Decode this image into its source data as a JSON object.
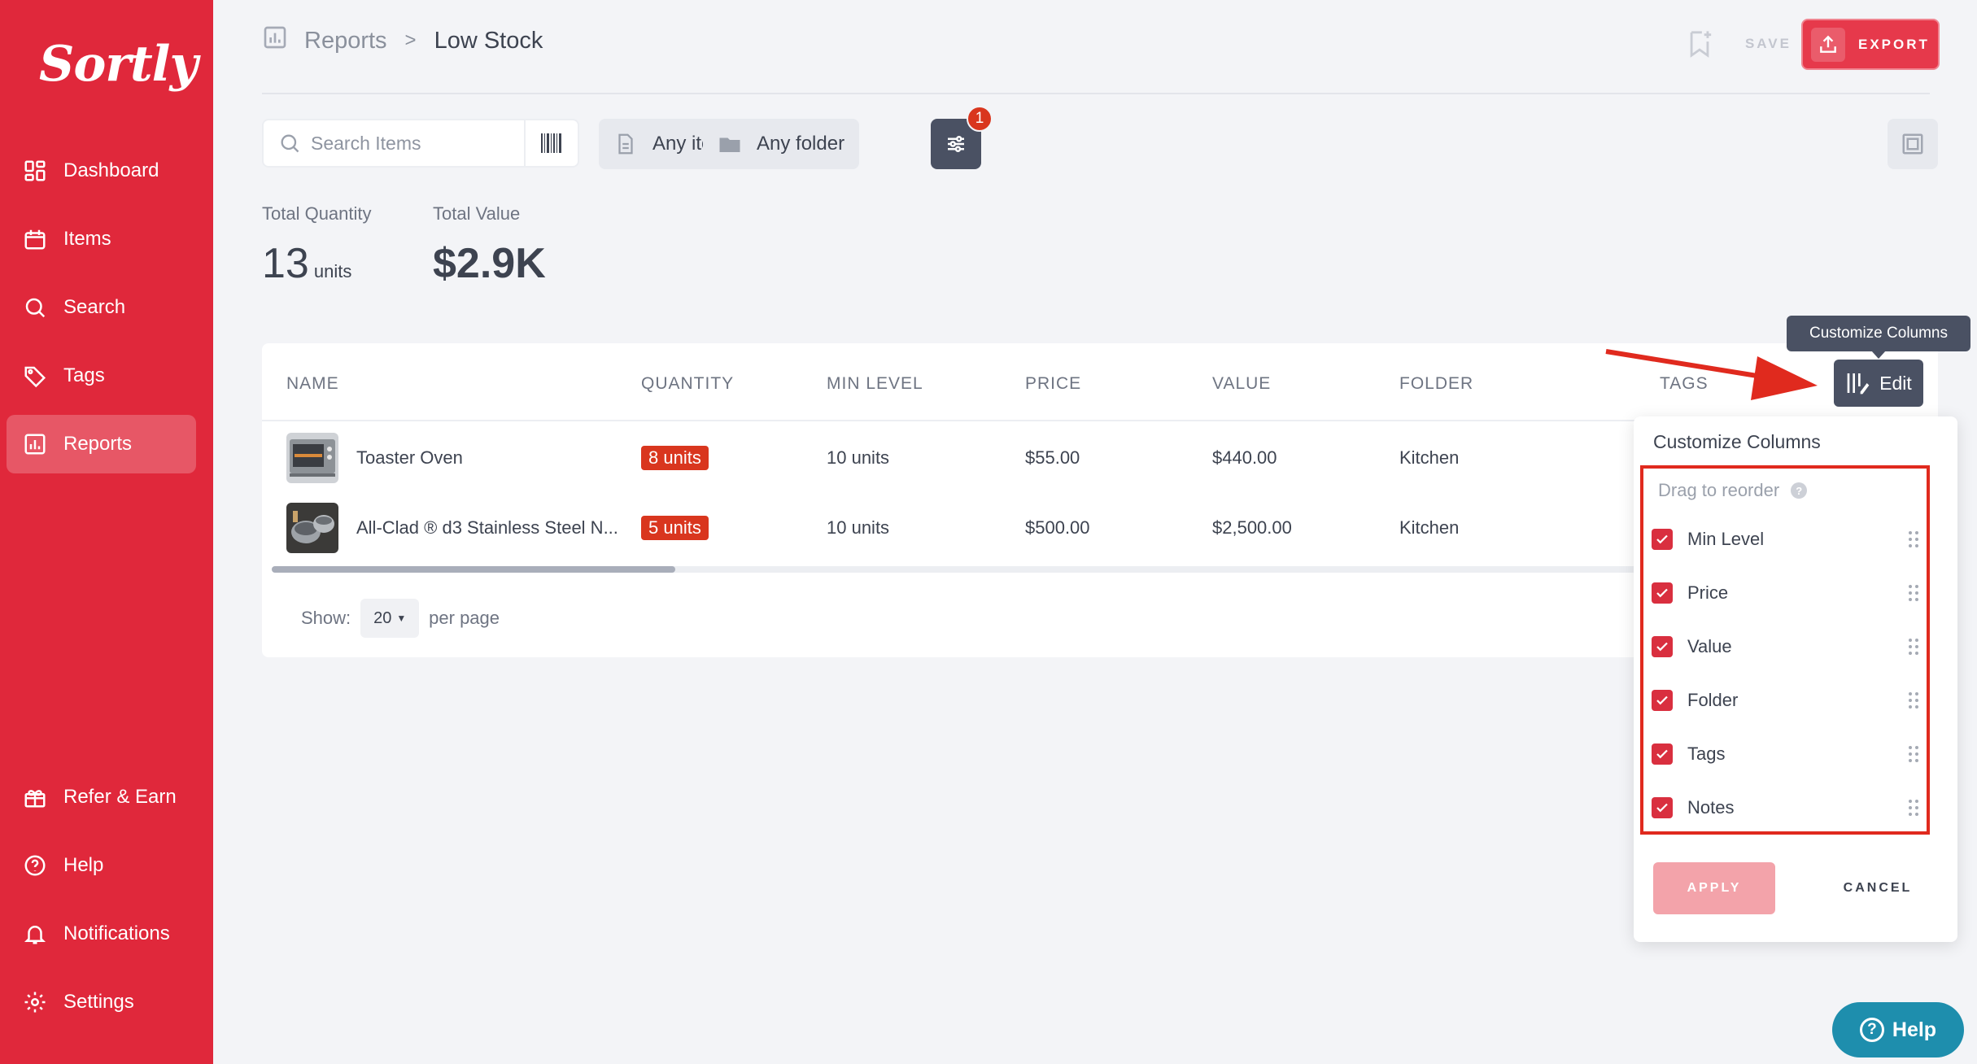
{
  "app": {
    "logo": "Sortly"
  },
  "sidebar": {
    "items": [
      {
        "label": "Dashboard",
        "icon": "dashboard-icon"
      },
      {
        "label": "Items",
        "icon": "items-icon"
      },
      {
        "label": "Search",
        "icon": "search-icon"
      },
      {
        "label": "Tags",
        "icon": "tag-icon"
      },
      {
        "label": "Reports",
        "icon": "reports-icon",
        "active": true
      },
      {
        "label": "Refer & Earn",
        "icon": "gift-icon"
      },
      {
        "label": "Help",
        "icon": "help-icon"
      },
      {
        "label": "Notifications",
        "icon": "bell-icon"
      },
      {
        "label": "Settings",
        "icon": "gear-icon"
      }
    ]
  },
  "header": {
    "breadcrumb_root": "Reports",
    "breadcrumb_sep": ">",
    "breadcrumb_current": "Low Stock",
    "save_label": "SAVE",
    "export_label": "EXPORT"
  },
  "toolbar": {
    "search_placeholder": "Search Items",
    "item_filter": "Any item",
    "folder_filter": "Any folder",
    "filter_count": "1"
  },
  "stats": {
    "total_quantity_label": "Total Quantity",
    "total_quantity_value": "13",
    "total_quantity_unit": "units",
    "total_value_label": "Total Value",
    "total_value_value": "$2.9K"
  },
  "table": {
    "columns": [
      "NAME",
      "QUANTITY",
      "MIN LEVEL",
      "PRICE",
      "VALUE",
      "FOLDER",
      "TAGS"
    ],
    "rows": [
      {
        "name": "Toaster Oven",
        "quantity": "8 units",
        "min_level": "10 units",
        "price": "$55.00",
        "value": "$440.00",
        "folder": "Kitchen"
      },
      {
        "name": "All-Clad ® d3 Stainless Steel N...",
        "quantity": "5 units",
        "min_level": "10 units",
        "price": "$500.00",
        "value": "$2,500.00",
        "folder": "Kitchen"
      }
    ],
    "pager_show": "Show:",
    "pager_value": "20",
    "pager_suffix": "per page"
  },
  "customize": {
    "tooltip": "Customize Columns",
    "edit_label": "Edit",
    "title": "Customize Columns",
    "drag_hint": "Drag to reorder",
    "columns": [
      "Min Level",
      "Price",
      "Value",
      "Folder",
      "Tags",
      "Notes"
    ],
    "apply_label": "APPLY",
    "cancel_label": "CANCEL"
  },
  "help_fab": {
    "label": "Help"
  },
  "colors": {
    "brand": "#e0283b",
    "badge": "#d9361e",
    "dark_button": "#4a5163",
    "help": "#1e8ead"
  }
}
